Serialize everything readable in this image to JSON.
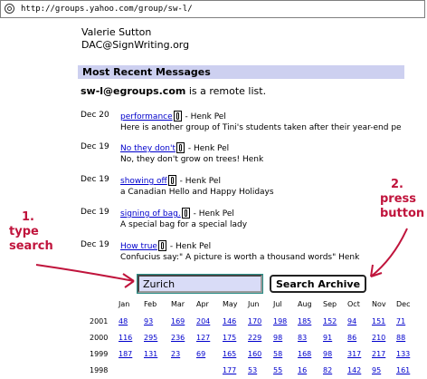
{
  "browser": {
    "url": "http://groups.yahoo.com/group/sw-l/",
    "page_icon": "globe-icon"
  },
  "owner": {
    "name": "Valerie Sutton",
    "email": "DAC@SignWriting.org"
  },
  "section_title": "Most Recent Messages",
  "remote": {
    "address": "sw-l@egroups.com",
    "text": " is a remote list."
  },
  "messages": [
    {
      "date": "Dec 20",
      "subject": "performance",
      "author": " - Henk Pel",
      "preview": "Here is another group of Tini's students taken after their year-end pe"
    },
    {
      "date": "Dec 19",
      "subject": "No they don't",
      "author": " - Henk Pel",
      "preview": "No, they don't grow on trees! Henk"
    },
    {
      "date": "Dec 19",
      "subject": "showing off",
      "author": " - Henk Pel",
      "preview": "a Canadian Hello and Happy Holidays"
    },
    {
      "date": "Dec 19",
      "subject": "signing of bag.",
      "author": " - Henk Pel",
      "preview": "A special bag for a special lady"
    },
    {
      "date": "Dec 19",
      "subject": "How true",
      "author": " - Henk Pel",
      "preview": "Confucius say:\" A picture is worth a thousand words\" Henk"
    }
  ],
  "annotations": {
    "left": [
      "1.",
      "type",
      "search"
    ],
    "right": [
      "2.",
      "press",
      "button"
    ],
    "color": "#c0143c"
  },
  "search": {
    "value": "Zurich",
    "button_label": "Search Archive"
  },
  "archive": {
    "months": [
      "Jan",
      "Feb",
      "Mar",
      "Apr",
      "May",
      "Jun",
      "Jul",
      "Aug",
      "Sep",
      "Oct",
      "Nov",
      "Dec"
    ],
    "rows": [
      {
        "year": "2001",
        "counts": [
          "48",
          "93",
          "169",
          "204",
          "146",
          "170",
          "198",
          "185",
          "152",
          "94",
          "151",
          "71"
        ]
      },
      {
        "year": "2000",
        "counts": [
          "116",
          "295",
          "236",
          "127",
          "175",
          "229",
          "98",
          "83",
          "91",
          "86",
          "210",
          "88"
        ]
      },
      {
        "year": "1999",
        "counts": [
          "187",
          "131",
          "23",
          "69",
          "165",
          "160",
          "58",
          "168",
          "98",
          "317",
          "217",
          "133"
        ]
      },
      {
        "year": "1998",
        "counts": [
          "",
          "",
          "",
          "",
          "177",
          "53",
          "55",
          "16",
          "82",
          "142",
          "95",
          "161"
        ]
      }
    ]
  }
}
